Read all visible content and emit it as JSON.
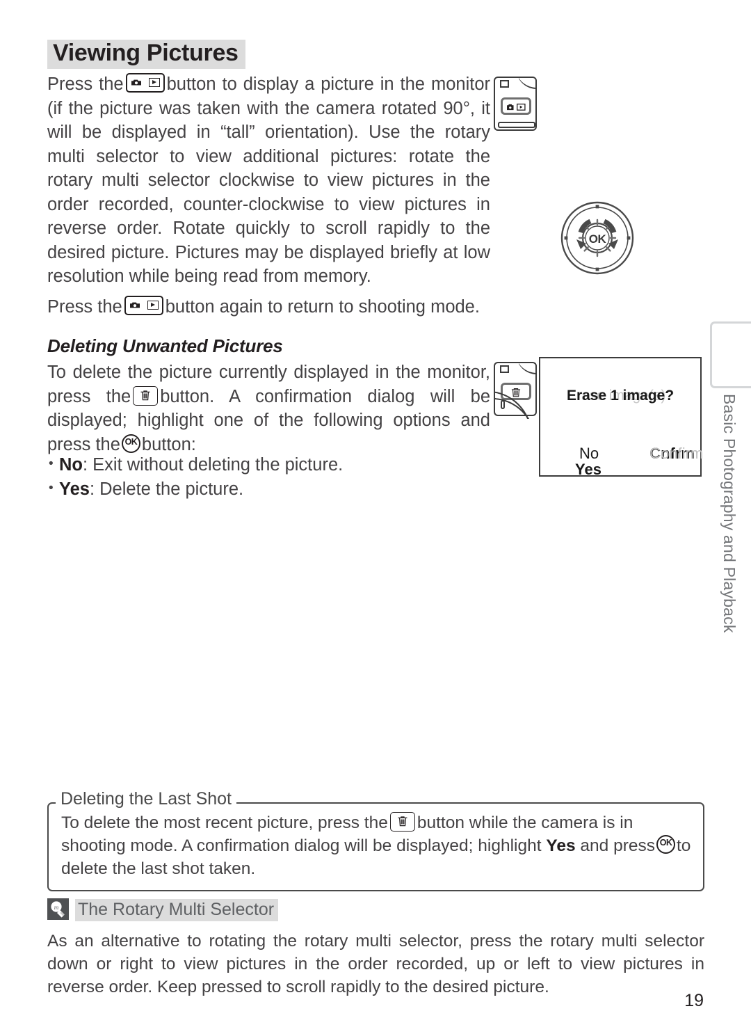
{
  "page": {
    "number": "19",
    "chapter_tab_label": "Basic Photography and Playback"
  },
  "section": {
    "title": "Viewing Pictures",
    "paragraph1_part1": "Press the",
    "paragraph1_part2": "button to display a picture in the monitor (if the picture was taken with the camera rotated 90°, it will be displayed in “tall” orientation).  Use the rotary multi selector to view additional pictures: rotate the rotary multi selector clockwise to view pictures in the order recorded, counter-clockwise to view pictures in reverse order.  Rotate quickly to scroll rapidly to the desired picture.  Pictures may be displayed briefly at low resolution while being read from memory.",
    "paragraph2_part1": "Press the",
    "paragraph2_part2": "button again to return to shooting mode."
  },
  "subsection": {
    "title": "Deleting Unwanted Pictures",
    "body_part1": "To delete the picture currently displayed in the monitor, press the",
    "body_part2": "button.  A confirmation dialog will be displayed; highlight one of the following options and press the",
    "body_part3": "button:",
    "options": [
      {
        "label": "No",
        "description": ": Exit without deleting the picture."
      },
      {
        "label": "Yes",
        "description": ": Delete the picture."
      }
    ]
  },
  "monitor": {
    "prompt": "Erase image(s)?",
    "prompt_overlay": "Erase 1 image?",
    "option_no": "No",
    "option_yes": "Yes",
    "confirm_label": "Confirm",
    "confirm_overlay": "Cnfrm"
  },
  "note_box": {
    "title": "Deleting the Last Shot",
    "body_part1": "To delete the most recent picture, press the",
    "body_part2": "button while the camera is in shooting mode.  A confirmation dialog will be displayed; highlight",
    "body_bold": "Yes",
    "body_part3": "and press",
    "body_part4": "to delete the last shot taken."
  },
  "tip": {
    "icon_name": "lightbulb-icon",
    "title": "The Rotary Multi Selector",
    "body": "As an alternative to rotating the rotary multi selector, press the rotary multi selector down or right to view pictures in the order recorded, up or left to view pictures in reverse order.  Keep pressed to scroll rapidly to the desired picture."
  },
  "figures": {
    "camera_playback_button": "camera-back-playback-button",
    "camera_delete_button": "camera-back-delete-button",
    "rotary_selector": "rotary-multi-selector",
    "rotary_center_label": "OK"
  }
}
